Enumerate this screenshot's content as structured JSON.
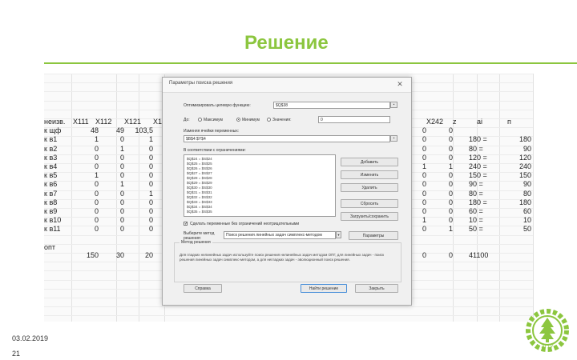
{
  "slide": {
    "title": "Решение",
    "date": "03.02.2019",
    "page_number": "21"
  },
  "sheet": {
    "top_headers": [
      "X111",
      "X112",
      "X121",
      "X1"
    ],
    "right_headers": [
      "X242",
      "z",
      "ai",
      "п"
    ],
    "row_labels": [
      "неизв.",
      "к щф",
      "к в1",
      "к в2",
      "к в3",
      "к в4",
      "к в5",
      "к в6",
      "к в7",
      "к в8",
      "к в9",
      "к в10",
      "к в11",
      "",
      "опт"
    ],
    "col_x111": [
      "",
      "48",
      "1",
      "0",
      "0",
      "0",
      "1",
      "0",
      "0",
      "0",
      "0",
      "0",
      "0",
      "",
      "150"
    ],
    "col_x112": [
      "",
      "49",
      "0",
      "1",
      "0",
      "0",
      "0",
      "1",
      "0",
      "0",
      "0",
      "0",
      "0",
      "",
      "30"
    ],
    "col_x121": [
      "",
      "103,5",
      "1",
      "0",
      "0",
      "0",
      "0",
      "0",
      "1",
      "0",
      "0",
      "0",
      "0",
      "",
      "20"
    ],
    "right_col_a": [
      "",
      "0",
      "0",
      "0",
      "0",
      "1",
      "0",
      "0",
      "0",
      "0",
      "0",
      "1",
      "0",
      "",
      "0"
    ],
    "right_col_z": [
      "",
      "0",
      "0",
      "0",
      "0",
      "1",
      "0",
      "0",
      "0",
      "0",
      "0",
      "0",
      "1",
      "",
      "0"
    ],
    "right_col_ai": [
      "",
      "",
      "180 =",
      "80 =",
      "120 =",
      "240 =",
      "150 =",
      "90 =",
      "80 =",
      "180 =",
      "60 =",
      "10 =",
      "50 =",
      "",
      "41100"
    ],
    "right_col_p": [
      "",
      "",
      "180",
      "90",
      "120",
      "240",
      "150",
      "90",
      "80",
      "180",
      "60",
      "10",
      "50",
      "",
      ""
    ]
  },
  "dialog": {
    "title": "Параметры поиска решения",
    "close_label": "✕",
    "objective_label": "Оптимизировать целевую функцию:",
    "objective_value": "$Q$38",
    "to_label": "До:",
    "opt_max": "Максимум",
    "opt_min": "Минимум",
    "opt_value": "Значения:",
    "value_field": "0",
    "changing_label": "Изменяя ячейки переменных:",
    "changing_value": "$B$4:$Y$4",
    "constraints_label": "В соответствии с ограничениями:",
    "constraints": [
      "$Q$24 = $S$24",
      "$Q$25 = $S$25",
      "$Q$26 = $S$26",
      "$Q$27 = $S$27",
      "$Q$28 = $S$28",
      "$Q$29 = $S$29",
      "$Q$30 = $S$30",
      "$Q$31 = $S$31",
      "$Q$32 = $S$32",
      "$Q$33 = $S$33",
      "$Q$34 = $S$34",
      "$Q$35 = $S$35"
    ],
    "btn_add": "Добавить",
    "btn_change": "Изменить",
    "btn_delete": "Удалить",
    "btn_reset": "Сбросить",
    "btn_load_save": "Загрузить/сохранить",
    "checkbox_label": "Сделать переменные без ограничений неотрицательными",
    "method_label": "Выберите метод решения:",
    "method_value": "Поиск решения линейных задач симплекс-методом",
    "btn_params": "Параметры",
    "method_group_title": "Метод решения",
    "method_description": "Для гладких нелинейных задач используйте поиск решения нелинейных задач методом ОПГ, для линейных задач - поиск решения линейных задач симплекс-методом, а для негладких задач - эволюционный поиск решения.",
    "btn_help": "Справка",
    "btn_solve": "Найти решение",
    "btn_close": "Закрыть"
  },
  "colors": {
    "accent": "#8cc63f",
    "dialog_bg": "#f0f0f0"
  },
  "logo": {
    "text": "АГТУ",
    "icon": "gear-tree-logo"
  }
}
